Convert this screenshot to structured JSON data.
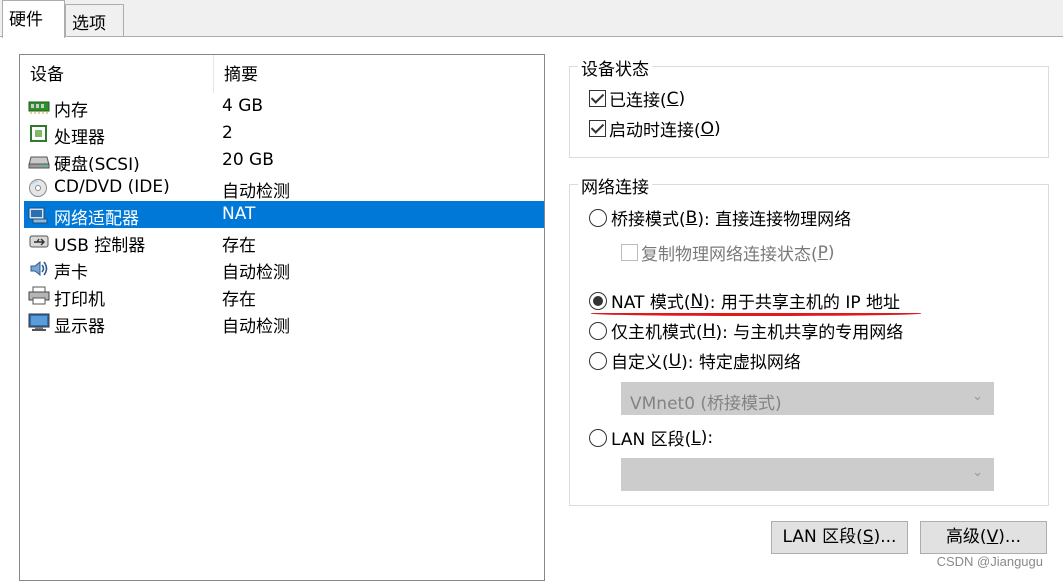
{
  "tabs": [
    {
      "label": "硬件",
      "active": true
    },
    {
      "label": "选项",
      "active": false
    }
  ],
  "device_list": {
    "headers": {
      "device": "设备",
      "summary": "摘要"
    },
    "rows": [
      {
        "icon": "memory-icon",
        "name": "内存",
        "summary": "4 GB"
      },
      {
        "icon": "processor-icon",
        "name": "处理器",
        "summary": "2"
      },
      {
        "icon": "harddisk-icon",
        "name": "硬盘(SCSI)",
        "summary": "20 GB"
      },
      {
        "icon": "cd-dvd-icon",
        "name": "CD/DVD (IDE)",
        "summary": "自动检测"
      },
      {
        "icon": "network-adapter-icon",
        "name": "网络适配器",
        "summary": "NAT",
        "selected": true
      },
      {
        "icon": "usb-icon",
        "name": "USB 控制器",
        "summary": "存在"
      },
      {
        "icon": "sound-card-icon",
        "name": "声卡",
        "summary": "自动检测"
      },
      {
        "icon": "printer-icon",
        "name": "打印机",
        "summary": "存在"
      },
      {
        "icon": "display-icon",
        "name": "显示器",
        "summary": "自动检测"
      }
    ]
  },
  "device_status": {
    "legend": "设备状态",
    "connected": {
      "label_pre": "已连接(",
      "key": "C",
      "label_post": ")",
      "checked": true
    },
    "connect_at_power_on": {
      "label_pre": "启动时连接(",
      "key": "O",
      "label_post": ")",
      "checked": true
    }
  },
  "network_connection": {
    "legend": "网络连接",
    "bridged": {
      "label_pre": "桥接模式(",
      "key": "B",
      "label_post": "): 直接连接物理网络",
      "selected": false
    },
    "replicate": {
      "label_pre": "复制物理网络连接状态(",
      "key": "P",
      "label_post": ")",
      "checked": false,
      "enabled": false
    },
    "nat": {
      "label_pre": "NAT 模式(",
      "key": "N",
      "label_post": "): 用于共享主机的 IP 地址",
      "selected": true
    },
    "host_only": {
      "label_pre": "仅主机模式(",
      "key": "H",
      "label_post": "): 与主机共享的专用网络",
      "selected": false
    },
    "custom": {
      "label_pre": "自定义(",
      "key": "U",
      "label_post": "): 特定虚拟网络",
      "selected": false
    },
    "custom_select": "VMnet0 (桥接模式)",
    "lan_segment": {
      "label_pre": "LAN 区段(",
      "key": "L",
      "label_post": "):",
      "selected": false
    },
    "lan_select": ""
  },
  "buttons": {
    "lan_segments": {
      "label_pre": "LAN 区段(",
      "key": "S",
      "label_post": ")..."
    },
    "advanced": {
      "label_pre": "高级(",
      "key": "V",
      "label_post": ")..."
    }
  },
  "watermark": "CSDN @Jiangugu",
  "colors": {
    "selection": "#0078d7",
    "annotation": "#e0191f"
  }
}
